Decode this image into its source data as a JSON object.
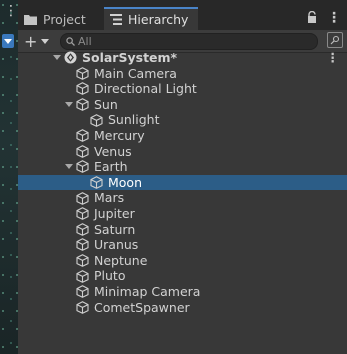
{
  "tabs": [
    {
      "label": "Project",
      "icon": "folder-icon"
    },
    {
      "label": "Hierarchy",
      "icon": "list-icon",
      "active": true
    }
  ],
  "search": {
    "placeholder": "All",
    "value": ""
  },
  "scene": {
    "name": "SolarSystem*",
    "icon": "unity-scene-icon"
  },
  "items": [
    {
      "label": "Main Camera",
      "depth": 1
    },
    {
      "label": "Directional Light",
      "depth": 1
    },
    {
      "label": "Sun",
      "depth": 1,
      "expanded": true
    },
    {
      "label": "Sunlight",
      "depth": 2
    },
    {
      "label": "Mercury",
      "depth": 1
    },
    {
      "label": "Venus",
      "depth": 1
    },
    {
      "label": "Earth",
      "depth": 1,
      "expanded": true
    },
    {
      "label": "Moon",
      "depth": 2,
      "selected": true
    },
    {
      "label": "Mars",
      "depth": 1
    },
    {
      "label": "Jupiter",
      "depth": 1
    },
    {
      "label": "Saturn",
      "depth": 1
    },
    {
      "label": "Uranus",
      "depth": 1
    },
    {
      "label": "Neptune",
      "depth": 1
    },
    {
      "label": "Pluto",
      "depth": 1
    },
    {
      "label": "Minimap Camera",
      "depth": 1
    },
    {
      "label": "CometSpawner",
      "depth": 1
    }
  ],
  "colors": {
    "selection": "#2c5d87",
    "background": "#383838",
    "tabbar": "#282828",
    "accent": "#4a84c8"
  }
}
